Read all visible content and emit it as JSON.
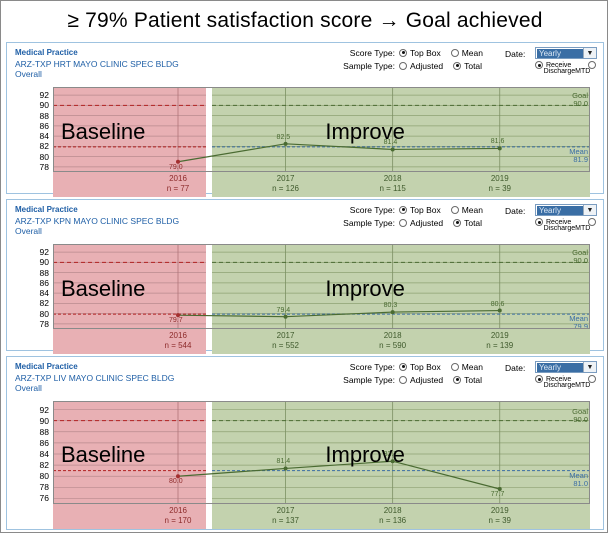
{
  "banner": {
    "title": "≥ 79% Patient satisfaction score → Goal achieved"
  },
  "controls": {
    "score_type_label": "Score Type:",
    "sample_type_label": "Sample Type:",
    "date_label": "Date:",
    "score_options": [
      "Top Box",
      "Mean"
    ],
    "score_selected": "Top Box",
    "sample_options": [
      "Adjusted",
      "Total"
    ],
    "sample_selected": "Total",
    "date_value": "Yearly",
    "dropdown_icon": "chevron-down-icon",
    "receive_label": "Receive",
    "discharge_label": "DischargeMTD",
    "receive_selected": true
  },
  "labels": {
    "baseline": "Baseline",
    "improve": "Improve",
    "goal_name": "Goal",
    "mean_name": "Mean",
    "org_line1": "Medical Practice",
    "section": "Overall"
  },
  "colors": {
    "baseline_zone": "#e8b0b4",
    "improve_zone": "#c3d2ae",
    "goal_line": "#4a6b32",
    "mean_line": "#3b6ea5",
    "series_line": "#4a6b32",
    "baseline_series": "#a33030",
    "header_text": "#1f5fa6",
    "panel_border": "#9fc3e0"
  },
  "panels": [
    {
      "org": "Medical Practice",
      "site": "ARZ-TXP HRT MAYO CLINIC SPEC BLDG",
      "section": "Overall",
      "chart_data": {
        "type": "line",
        "title": "ARZ-TXP HRT MAYO CLINIC SPEC BLDG",
        "xlabel": "",
        "ylabel": "",
        "categories": [
          "2016",
          "2017",
          "2018",
          "2019"
        ],
        "values": [
          79.0,
          82.5,
          81.4,
          81.6
        ],
        "n": [
          "n = 77",
          "n = 126",
          "n = 115",
          "n = 39"
        ],
        "yticks": [
          92,
          90,
          88,
          86,
          84,
          82,
          80,
          78
        ],
        "ylim": [
          77,
          93
        ],
        "goal": 90.0,
        "goal_label": "90.0",
        "mean": 81.9,
        "mean_label": "81.9",
        "baseline_categories": [
          "2016"
        ],
        "grid": true,
        "legend": "none"
      }
    },
    {
      "org": "Medical Practice",
      "site": "ARZ-TXP KPN MAYO CLINIC SPEC BLDG",
      "section": "Overall",
      "chart_data": {
        "type": "line",
        "title": "ARZ-TXP KPN MAYO CLINIC SPEC BLDG",
        "xlabel": "",
        "ylabel": "",
        "categories": [
          "2016",
          "2017",
          "2018",
          "2019"
        ],
        "values": [
          79.7,
          79.4,
          80.3,
          80.6
        ],
        "n": [
          "n = 544",
          "n = 552",
          "n = 590",
          "n = 139"
        ],
        "yticks": [
          92,
          90,
          88,
          86,
          84,
          82,
          80,
          78
        ],
        "ylim": [
          77,
          93
        ],
        "goal": 90.0,
        "goal_label": "90.0",
        "mean": 79.9,
        "mean_label": "79.9",
        "baseline_categories": [
          "2016"
        ],
        "grid": true,
        "legend": "none"
      }
    },
    {
      "org": "Medical Practice",
      "site": "ARZ-TXP LIV MAYO CLINIC SPEC BLDG",
      "section": "Overall",
      "chart_data": {
        "type": "line",
        "title": "ARZ-TXP LIV MAYO CLINIC SPEC BLDG",
        "xlabel": "",
        "ylabel": "",
        "categories": [
          "2016",
          "2017",
          "2018",
          "2019"
        ],
        "values": [
          80.0,
          81.4,
          82.7,
          77.7
        ],
        "n": [
          "n = 170",
          "n = 137",
          "n = 136",
          "n = 39"
        ],
        "yticks": [
          92,
          90,
          88,
          86,
          84,
          82,
          80,
          78,
          76
        ],
        "ylim": [
          75,
          93
        ],
        "goal": 90.0,
        "goal_label": "90.0",
        "mean": 81.0,
        "mean_label": "81.0",
        "baseline_categories": [
          "2016"
        ],
        "grid": true,
        "legend": "none"
      }
    }
  ]
}
